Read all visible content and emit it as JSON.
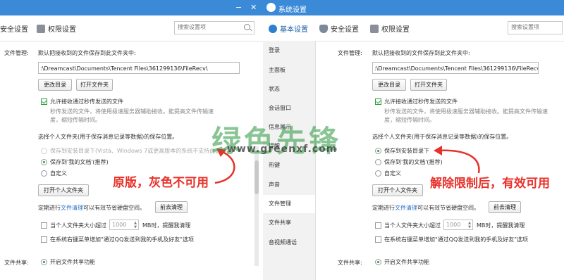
{
  "left_panel": {
    "titlebar": {
      "minimize": "−",
      "close": "✕"
    },
    "tabs": [
      "安全设置",
      "权限设置"
    ],
    "search_placeholder": "搜索设置项",
    "section_file_mgmt": "文件管理:",
    "save_to_label": "默认把接收到的文件保存到此文件夹中:",
    "path_value": ":\\Dreamcast\\Documents\\Tencent Files\\361299136\\FileRecv\\",
    "btn_change_dir": "更改目录",
    "btn_open_folder": "打开文件夹",
    "allow_flash_transfer": "允许接收通过秒传发送的文件",
    "flash_hint_1": "秒传发送的文件，将使用极速服务器辅助接收。能提高文件传输速",
    "flash_hint_2": "度，缩短传输时间。",
    "personal_folder_label": "选择个人文件夹(用于保存消息记录等数据)的保存位置。",
    "radio_install_dir": "保存到安装目录下(Vista、Windows 7或更高版本的系统不支持此选项)",
    "radio_my_docs": "保存到'我的文档'(推荐)",
    "radio_custom": "自定义",
    "btn_open_personal": "打开个人文件夹",
    "cleanup_text_pre": "定期进行",
    "cleanup_link": "文件清理",
    "cleanup_text_post": "可以有效节省硬盘空间。",
    "btn_cleanup": "前去清理",
    "size_alert_pre": "当个人文件夹大小超过",
    "size_value": "1000",
    "size_alert_post": "MB时，提醒我清理",
    "context_menu_option": "在系统右键菜单增加\"通过QQ发送到我的手机及好友\"选项",
    "section_file_share": "文件共享:",
    "enable_share": "开启文件共享功能",
    "annotation": "原版，灰色不可用"
  },
  "right_panel": {
    "titlebar_title": "系统设置",
    "tabs": [
      "基本设置",
      "安全设置",
      "权限设置"
    ],
    "search_placeholder": "搜索设置项",
    "sidebar": [
      "登录",
      "主面板",
      "状态",
      "会话窗口",
      "信息展示",
      "提醒",
      "热键",
      "声音",
      "文件管理",
      "文件共享",
      "音视频通话"
    ],
    "active_sidebar": "文件管理",
    "section_file_mgmt": "文件管理:",
    "save_to_label": "默认把接收到的文件保存到此文件夹中:",
    "path_value": ":\\Dreamcast\\Documents\\Tencent Files\\361299136\\FileRecv\\",
    "btn_change_dir": "更改目录",
    "btn_open_folder": "打开文件夹",
    "allow_flash_transfer": "允许接收通过秒传发送的文件",
    "flash_hint_1": "秒传发送的文件，将使用极速服务器辅助接收。能提高文件传输速",
    "flash_hint_2": "度，缩短传输时间。",
    "personal_folder_label": "选择个人文件夹(用于保存消息记录等数据)的保存位置。",
    "radio_install_dir": "保存到安装目录下",
    "radio_my_docs": "保存到'我的文档'(推荐)",
    "radio_custom": "自定义",
    "btn_open_personal": "打开个人文件夹",
    "cleanup_text_pre": "定期进行",
    "cleanup_link": "文件清理",
    "cleanup_text_post": "可以有效节省硬盘空间。",
    "btn_cleanup": "前去清理",
    "size_alert_pre": "当个人文件夹大小超过",
    "size_value": "1000",
    "size_alert_post": "MB时，提醒我清理",
    "context_menu_option": "在系统右键菜单增加\"通过QQ发送到我的手机及好友\"选项",
    "section_file_share": "文件共享:",
    "enable_share": "开启文件共享功能",
    "annotation": "解除限制后，有效可用"
  },
  "watermark": {
    "text": "绿色先锋",
    "url": "www.greenxf.com"
  },
  "colors": {
    "titlebar": "#3a8ad8",
    "accent_green": "#2b9a3c",
    "annotation_red": "#e8312a",
    "link_blue": "#2b73c8"
  }
}
